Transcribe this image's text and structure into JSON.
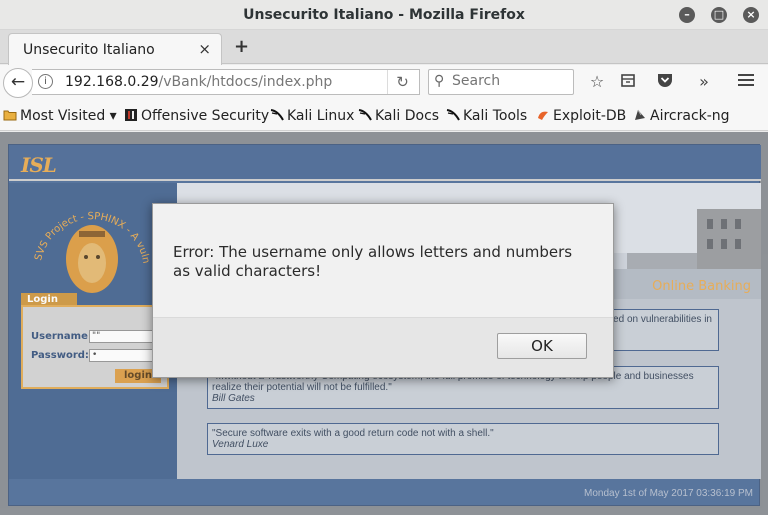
{
  "window": {
    "title": "Unsecurito Italiano - Mozilla Firefox"
  },
  "tab": {
    "label": "Unsecurito Italiano",
    "close": "×",
    "new_tab": "+"
  },
  "nav": {
    "url_host": "192.168.0.29",
    "url_path": "/vBank/htdocs/index.php",
    "search_placeholder": "Search"
  },
  "bookmarks": [
    {
      "label": "Most Visited",
      "icon": "folder-icon"
    },
    {
      "label": "Offensive Security",
      "icon": "offsec-icon"
    },
    {
      "label": "Kali Linux",
      "icon": "kali-icon"
    },
    {
      "label": "Kali Docs",
      "icon": "kali-icon"
    },
    {
      "label": "Kali Tools",
      "icon": "kali-icon"
    },
    {
      "label": "Exploit-DB",
      "icon": "exploitdb-icon"
    },
    {
      "label": "Aircrack-ng",
      "icon": "aircrack-icon"
    }
  ],
  "page": {
    "logo": "ISL",
    "emblem_text": "SVS Project - SPHINX - A vulnerable Web App",
    "online_banking": "Online Banking",
    "login": {
      "tab": "Login",
      "username_label": "Username:",
      "username_value": "\"\"",
      "password_label": "Password:",
      "password_value": "•",
      "button": "login"
    },
    "quotes": [
      {
        "text": "ed on vulnerabilities in",
        "author": ""
      },
      {
        "text": "\"...without a Trustworthy Computing ecosystem, the full promise of technology to help people and businesses realize their potential will not be fulfilled.\"",
        "author": "Bill Gates"
      },
      {
        "text": "\"Secure software exits with a good return code not with a shell.\"",
        "author": "Venard Luxe"
      }
    ],
    "footer_date": "Monday 1st of May 2017 03:36:19 PM"
  },
  "dialog": {
    "message": "Error: The username only allows letters and numbers as valid characters!",
    "ok_label": "OK"
  }
}
